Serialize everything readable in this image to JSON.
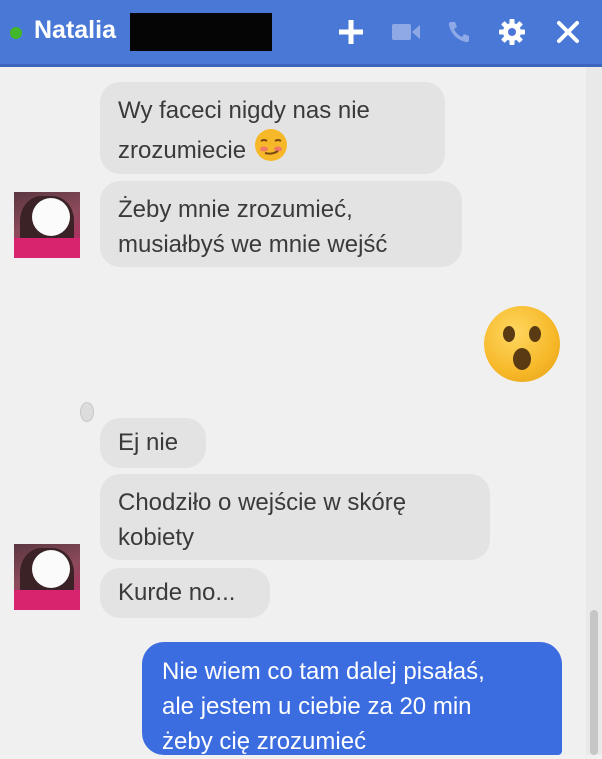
{
  "header": {
    "contact_name": "Natalia",
    "icons": [
      "plus-icon",
      "video-camera-icon",
      "phone-icon",
      "gear-icon",
      "close-icon"
    ],
    "accent_color": "#4a78d6",
    "online_color": "#42b72a"
  },
  "messages": [
    {
      "from": "contact",
      "lines": [
        "Wy faceci nigdy nas nie",
        "zrozumiecie"
      ],
      "emoji": "smirk-emoji"
    },
    {
      "from": "contact",
      "lines": [
        "Żeby mnie zrozumieć,",
        "musiałbyś we mnie wejść"
      ]
    },
    {
      "from": "me",
      "emoji": "surprised-emoji"
    },
    {
      "from": "contact",
      "lines": [
        "Ej nie"
      ]
    },
    {
      "from": "contact",
      "lines": [
        "Chodziło o wejście w skórę",
        "kobiety"
      ]
    },
    {
      "from": "contact",
      "lines": [
        "Kurde no..."
      ]
    },
    {
      "from": "me",
      "lines": [
        "Nie wiem co tam dalej pisałaś,",
        "ale jestem u ciebie za 20 min",
        "żeby cię zrozumieć"
      ]
    }
  ]
}
